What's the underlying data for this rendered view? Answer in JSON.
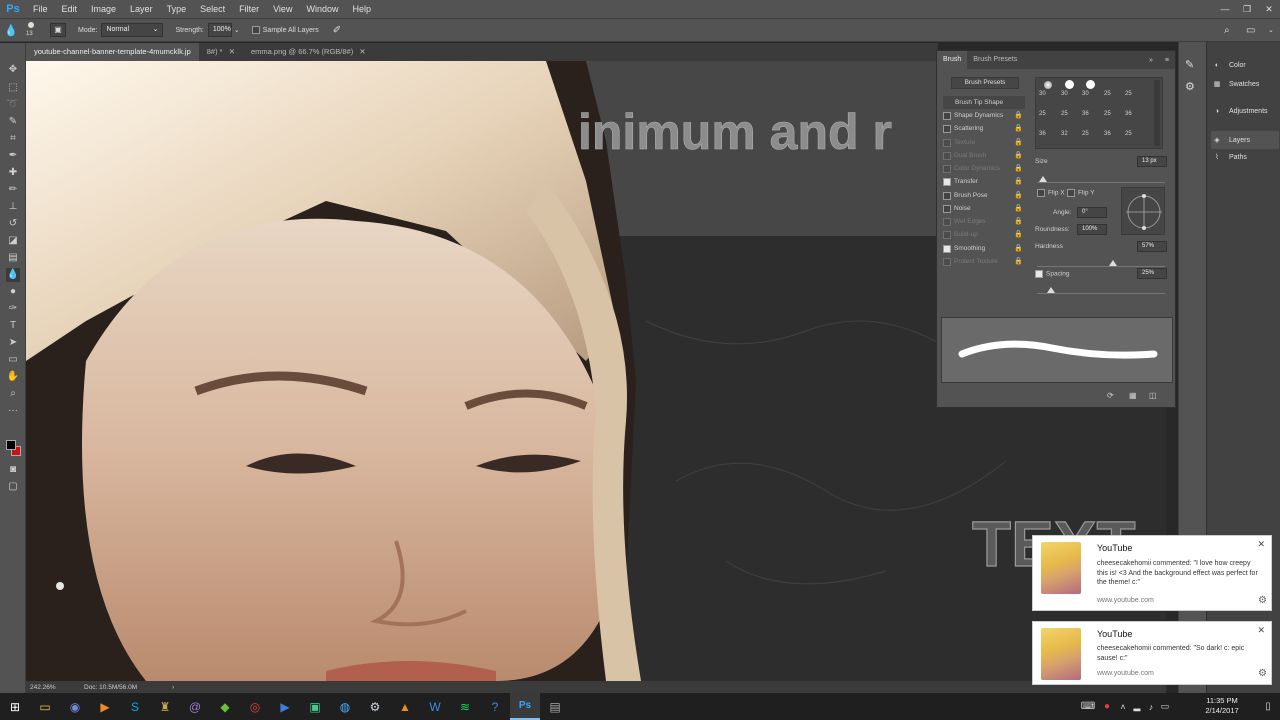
{
  "app": {
    "logo": "Ps",
    "menus": [
      "File",
      "Edit",
      "Image",
      "Layer",
      "Type",
      "Select",
      "Filter",
      "View",
      "Window",
      "Help"
    ],
    "window_controls": [
      "—",
      "❐",
      "✕"
    ]
  },
  "options_bar": {
    "brush_size": "13",
    "mode_label": "Mode:",
    "mode_value": "Normal",
    "strength_label": "Strength:",
    "strength_value": "100%",
    "sample_all_layers_label": "Sample All Layers"
  },
  "tabs": [
    {
      "label": "youtube-channel-banner-template-4mumcklk.jp",
      "active": true
    },
    {
      "label": "8#) *",
      "active": false
    },
    {
      "label": "emma.png @ 66.7% (RGB/8#)",
      "active": false
    }
  ],
  "canvas": {
    "headline": "inimum and r",
    "watermark": "TEXT"
  },
  "status": {
    "zoom": "242.26%",
    "doc": "Doc: 10.5M/56.0M"
  },
  "brush_panel": {
    "tab_brush": "Brush",
    "tab_presets": "Brush Presets",
    "presets_button": "Brush Presets",
    "options": [
      {
        "label": "Brush Tip Shape",
        "checked": false,
        "selected": true,
        "enabled": true
      },
      {
        "label": "Shape Dynamics",
        "checked": false,
        "enabled": true
      },
      {
        "label": "Scattering",
        "checked": false,
        "enabled": true
      },
      {
        "label": "Texture",
        "checked": false,
        "enabled": false
      },
      {
        "label": "Dual Brush",
        "checked": false,
        "enabled": false
      },
      {
        "label": "Color Dynamics",
        "checked": false,
        "enabled": false
      },
      {
        "label": "Transfer",
        "checked": true,
        "enabled": true
      },
      {
        "label": "Brush Pose",
        "checked": false,
        "enabled": true
      },
      {
        "label": "Noise",
        "checked": false,
        "enabled": true
      },
      {
        "label": "Wet Edges",
        "checked": false,
        "enabled": false
      },
      {
        "label": "Build-up",
        "checked": false,
        "enabled": false
      },
      {
        "label": "Smoothing",
        "checked": true,
        "enabled": true
      },
      {
        "label": "Protect Texture",
        "checked": false,
        "enabled": false
      }
    ],
    "tip_sizes": [
      "30",
      "30",
      "30",
      "25",
      "25",
      "25",
      "25",
      "36",
      "25",
      "36",
      "36",
      "32",
      "25",
      "36",
      "25"
    ],
    "size_label": "Size",
    "size_value": "13 px",
    "flip_x": "Flip X",
    "flip_y": "Flip Y",
    "angle_label": "Angle:",
    "angle_value": "0°",
    "roundness_label": "Roundness:",
    "roundness_value": "100%",
    "hardness_label": "Hardness",
    "hardness_value": "57%",
    "spacing_label": "Spacing",
    "spacing_value": "25%"
  },
  "right_dock": {
    "items": [
      "Color",
      "Swatches",
      "Adjustments",
      "Layers",
      "Paths"
    ]
  },
  "notifications": [
    {
      "title": "YouTube",
      "body": "cheesecakehomii commented: \"I love how creepy this is! <3 And the background effect was perfect for the theme! c:\"",
      "site": "www.youtube.com"
    },
    {
      "title": "YouTube",
      "body": "cheesecakehomii commented: \"So dark! c: epic sause! c:\"",
      "site": "www.youtube.com"
    }
  ],
  "taskbar": {
    "time": "11:35 PM",
    "date": "2/14/2017"
  },
  "colors": {
    "foreground": "#000000",
    "background": "#d01010",
    "ps_blue": "#31a8ff"
  }
}
